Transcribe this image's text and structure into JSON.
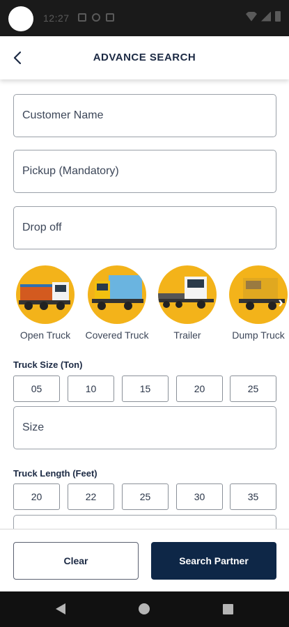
{
  "status_bar": {
    "time": "12:27"
  },
  "header": {
    "title": "ADVANCE SEARCH",
    "back_icon": "arrow-left-icon"
  },
  "fields": {
    "customer_name_placeholder": "Customer Name",
    "pickup_placeholder": "Pickup (Mandatory)",
    "dropoff_placeholder": "Drop off",
    "size_placeholder": "Size"
  },
  "vehicle_types": [
    {
      "label": "Open Truck"
    },
    {
      "label": "Covered Truck"
    },
    {
      "label": "Trailer"
    },
    {
      "label": "Dump Truck"
    }
  ],
  "vehicle_accent_color": "#f3b31a",
  "truck_size": {
    "label": "Truck Size (Ton)",
    "options": [
      "05",
      "10",
      "15",
      "20",
      "25"
    ]
  },
  "truck_length": {
    "label": "Truck Length (Feet)",
    "options": [
      "20",
      "22",
      "25",
      "30",
      "35"
    ]
  },
  "actions": {
    "clear_label": "Clear",
    "search_label": "Search Partner"
  },
  "colors": {
    "primary": "#0e2747",
    "text": "#1c2a44"
  }
}
